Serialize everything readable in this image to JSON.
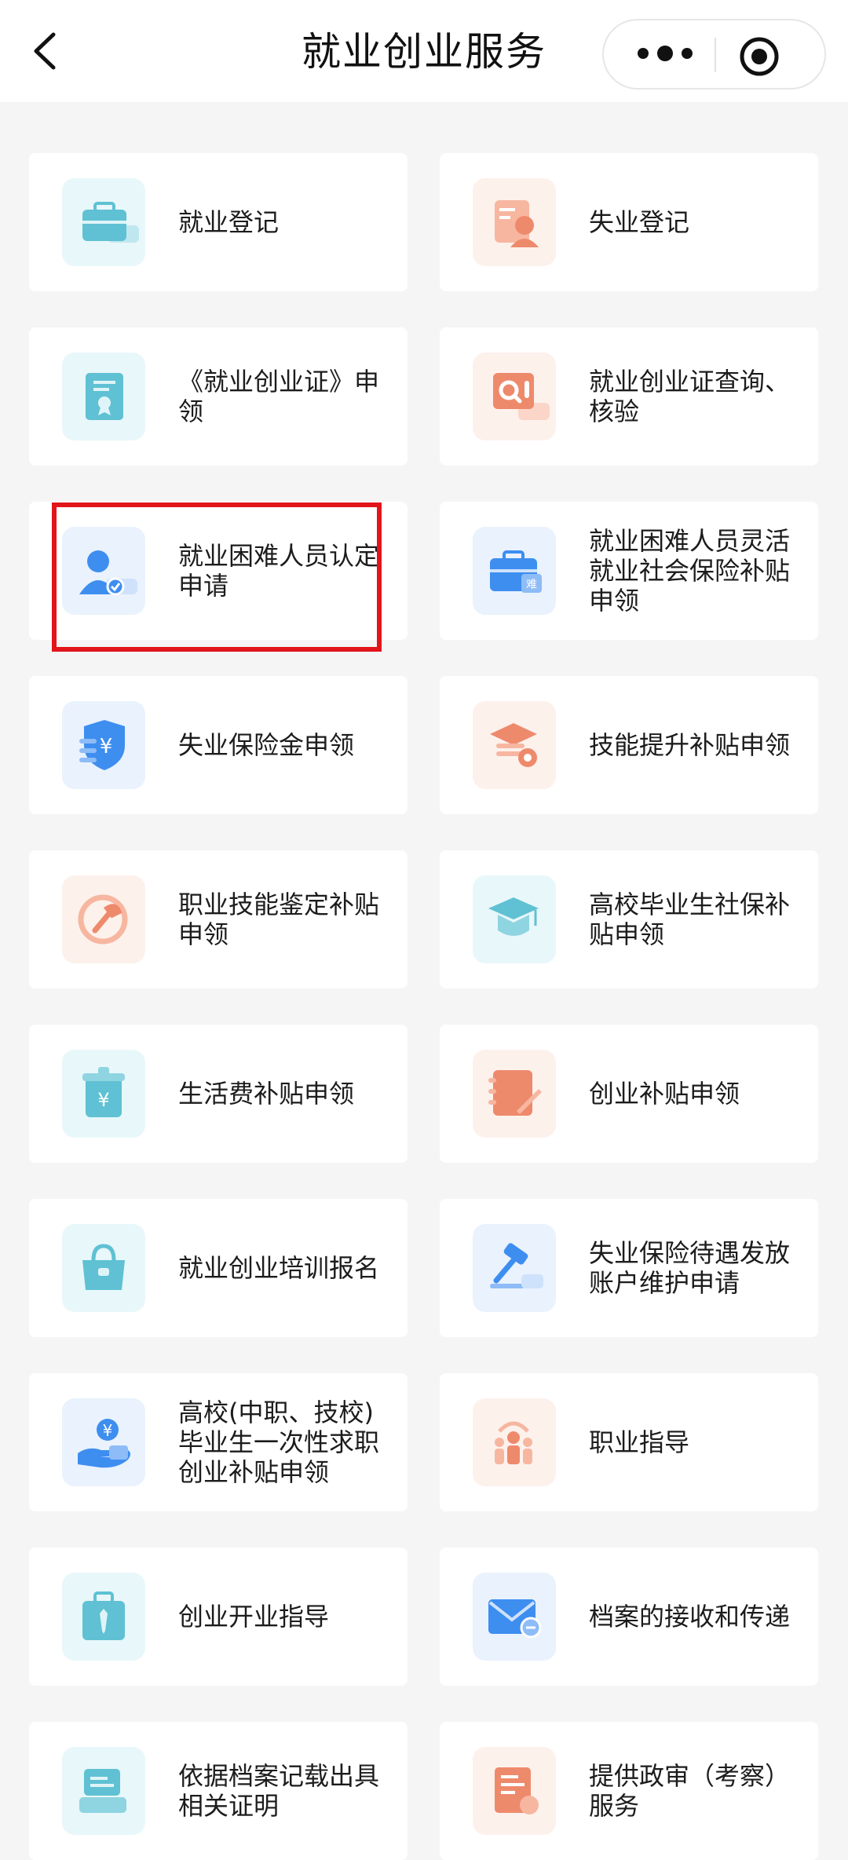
{
  "header": {
    "title": "就业创业服务",
    "back_icon": "chevron-left-icon",
    "more_icon": "more-dots-icon",
    "close_icon": "target-icon"
  },
  "colors": {
    "teal_tile": "#e8f7fa",
    "salmon_tile": "#fdf1ec",
    "blue_tile": "#e9f2fd",
    "highlight": "#e1151a"
  },
  "services": [
    {
      "label": "就业登记",
      "icon": "briefcase-icon"
    },
    {
      "label": "失业登记",
      "icon": "user-card-icon"
    },
    {
      "label": "《就业创业证》申领",
      "icon": "certificate-icon"
    },
    {
      "label": "就业创业证查询、核验",
      "icon": "query-icon"
    },
    {
      "label": "就业困难人员认定申请",
      "icon": "person-check-icon"
    },
    {
      "label": "就业困难人员灵活就业社会保险补贴申领",
      "icon": "briefcase-badge-icon"
    },
    {
      "label": "失业保险金申领",
      "icon": "shield-yuan-icon"
    },
    {
      "label": "技能提升补贴申领",
      "icon": "graduation-gear-icon"
    },
    {
      "label": "职业技能鉴定补贴申领",
      "icon": "wrench-circle-icon"
    },
    {
      "label": "高校毕业生社保补贴申领",
      "icon": "graduation-cap-icon"
    },
    {
      "label": "生活费补贴申领",
      "icon": "jar-yuan-icon"
    },
    {
      "label": "创业补贴申领",
      "icon": "notebook-pen-icon"
    },
    {
      "label": "就业创业培训报名",
      "icon": "bag-icon"
    },
    {
      "label": "失业保险待遇发放账户维护申请",
      "icon": "gavel-icon"
    },
    {
      "label": "高校(中职、技校)毕业生一次性求职创业补贴申领",
      "icon": "hand-coin-icon"
    },
    {
      "label": "职业指导",
      "icon": "people-group-icon"
    },
    {
      "label": "创业开业指导",
      "icon": "briefcase-tie-icon"
    },
    {
      "label": "档案的接收和传递",
      "icon": "mail-transfer-icon"
    },
    {
      "label": "依据档案记载出具相关证明",
      "icon": "document-print-icon"
    },
    {
      "label": "提供政审（考察）服务",
      "icon": "document-stamp-icon"
    }
  ]
}
